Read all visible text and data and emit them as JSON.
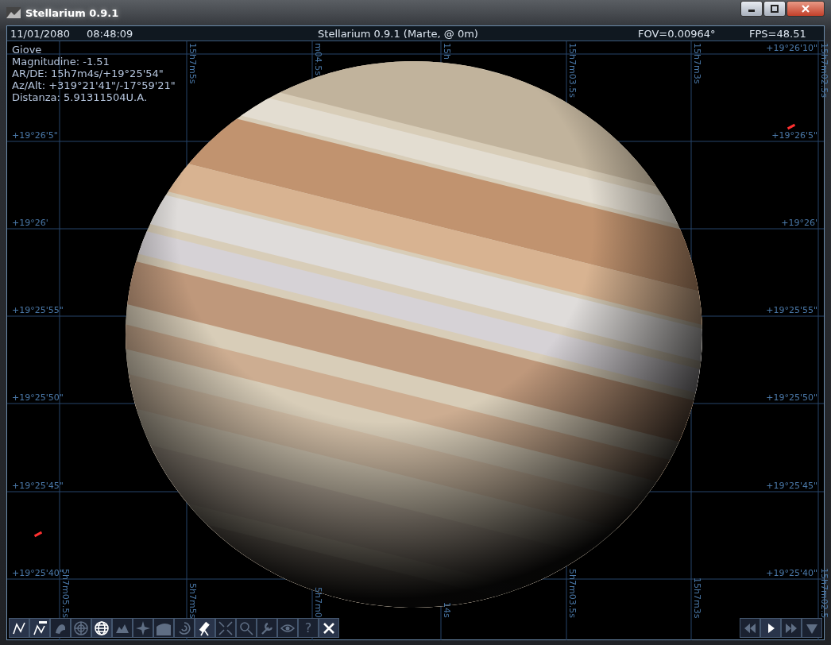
{
  "window": {
    "title": "Stellarium 0.9.1"
  },
  "status_bar": {
    "date": "11/01/2080",
    "time": "08:48:09",
    "location": "Stellarium 0.9.1 (Marte,  @ 0m)",
    "fov": "FOV=0.00964°",
    "fps": "FPS=48.51"
  },
  "object_info": {
    "name": "Giove",
    "lines": [
      "Magnitudine: -1.51",
      "AR/DE: 15h7m4s/+19°25'54\"",
      "Az/Alt: +319°21'41\"/-17°59'21\"",
      "Distanza: 5.91311504U.A."
    ]
  },
  "sky": {
    "dec_labels_left": [
      "+19°26'5\"",
      "+19°26'",
      "+19°25'55\"",
      "+19°25'50\"",
      "+19°25'45\"",
      "+19°25'40\""
    ],
    "dec_labels_right": [
      "+19°26'10\"",
      "+19°26'5\"",
      "+19°26'",
      "+19°25'55\"",
      "+19°25'50\"",
      "+19°25'45\"",
      "+19°25'40\""
    ],
    "ra_labels_top": [
      "15h7m5s",
      "m04.5s",
      "15h",
      "15h7m03.5s",
      "15h7m3s",
      "15h7m02.5s"
    ],
    "ra_labels_bottom": [
      "5h7m05.5s",
      "5h7m5s",
      "5h7m0",
      "14s",
      "5h7m03.5s",
      "15h7m3s",
      "15h7m02.5"
    ]
  },
  "toolbar": [
    {
      "kind": "lines",
      "on": true
    },
    {
      "kind": "lines-labeled",
      "on": true
    },
    {
      "kind": "art",
      "on": false
    },
    {
      "kind": "grid-eq",
      "on": false
    },
    {
      "kind": "grid-az",
      "on": true
    },
    {
      "kind": "ground",
      "on": false
    },
    {
      "kind": "cardinal",
      "on": false
    },
    {
      "kind": "atmosphere",
      "on": false
    },
    {
      "kind": "nebula",
      "on": false
    },
    {
      "kind": "telescope",
      "on": true
    },
    {
      "kind": "fullscreen",
      "on": false
    },
    {
      "kind": "search",
      "on": false
    },
    {
      "kind": "settings",
      "on": false
    },
    {
      "kind": "eye",
      "on": false
    },
    {
      "kind": "help",
      "on": false,
      "label": "?"
    },
    {
      "kind": "quit",
      "on": true
    }
  ],
  "time_controls": [
    {
      "kind": "rewind",
      "on": false
    },
    {
      "kind": "play",
      "on": true
    },
    {
      "kind": "forward",
      "on": false
    },
    {
      "kind": "down",
      "on": false
    }
  ]
}
